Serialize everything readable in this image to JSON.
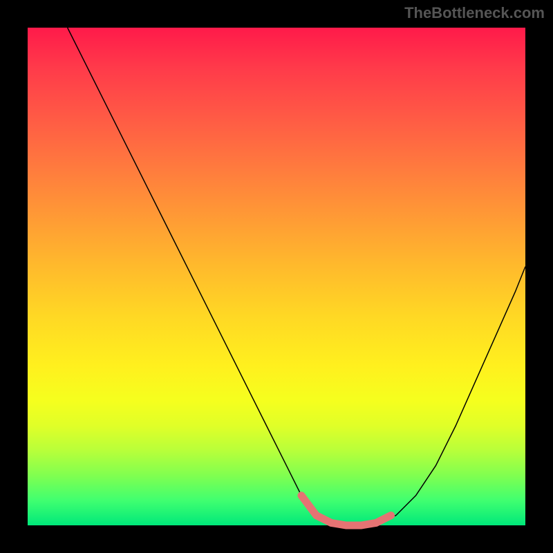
{
  "watermark": "TheBottleneck.com",
  "chart_data": {
    "type": "line",
    "title": "",
    "xlabel": "",
    "ylabel": "",
    "xlim": [
      0,
      100
    ],
    "ylim": [
      0,
      100
    ],
    "series": [
      {
        "name": "bottleneck-curve",
        "x": [
          8,
          12,
          16,
          20,
          24,
          28,
          32,
          36,
          40,
          44,
          48,
          52,
          55,
          58,
          61,
          64,
          67,
          70,
          74,
          78,
          82,
          86,
          90,
          94,
          98,
          100
        ],
        "values": [
          100,
          92,
          84,
          76,
          68,
          60,
          52,
          44,
          36,
          28,
          20,
          12,
          6,
          2,
          0.5,
          0,
          0,
          0.5,
          2,
          6,
          12,
          20,
          29,
          38,
          47,
          52
        ]
      }
    ],
    "highlight": {
      "name": "well-region",
      "x": [
        55,
        58,
        61,
        64,
        67,
        70,
        73
      ],
      "values": [
        6,
        2,
        0.5,
        0,
        0,
        0.5,
        2
      ]
    },
    "colors": {
      "curve": "#000000",
      "highlight": "#e57373",
      "gradient_top": "#ff1a4a",
      "gradient_bottom": "#00e87a"
    }
  }
}
